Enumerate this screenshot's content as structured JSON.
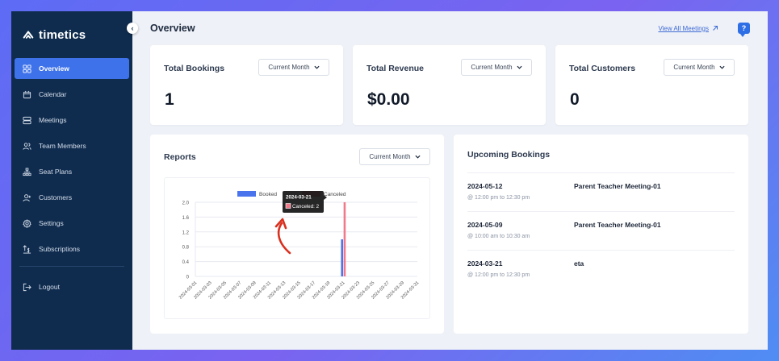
{
  "app": {
    "name": "timetics"
  },
  "sidebar": {
    "items": [
      {
        "label": "Overview",
        "icon": "grid-icon",
        "active": true
      },
      {
        "label": "Calendar",
        "icon": "calendar-icon",
        "active": false
      },
      {
        "label": "Meetings",
        "icon": "meetings-icon",
        "active": false
      },
      {
        "label": "Team Members",
        "icon": "team-icon",
        "active": false
      },
      {
        "label": "Seat Plans",
        "icon": "seat-plan-icon",
        "active": false
      },
      {
        "label": "Customers",
        "icon": "customers-icon",
        "active": false
      },
      {
        "label": "Settings",
        "icon": "gear-icon",
        "active": false
      },
      {
        "label": "Subscriptions",
        "icon": "subscriptions-icon",
        "active": false
      }
    ],
    "logout": "Logout",
    "collapse_glyph": "‹"
  },
  "header": {
    "title": "Overview",
    "view_all": "View All Meetings",
    "help_glyph": "?"
  },
  "stats": [
    {
      "title": "Total Bookings",
      "value": "1",
      "filter": "Current Month"
    },
    {
      "title": "Total Revenue",
      "value": "$0.00",
      "filter": "Current Month"
    },
    {
      "title": "Total Customers",
      "value": "0",
      "filter": "Current Month"
    }
  ],
  "reports": {
    "title": "Reports",
    "filter": "Current Month",
    "tooltip": {
      "date": "2024-03-21",
      "label": "Canceled: 2"
    }
  },
  "chart_data": {
    "type": "bar",
    "title": "",
    "xlabel": "",
    "ylabel": "",
    "ylim": [
      0,
      2.0
    ],
    "yticks": [
      "0",
      "0.4",
      "0.8",
      "1.2",
      "1.6",
      "2.0"
    ],
    "grid": true,
    "legend": "top",
    "categories": [
      "2024-03-01",
      "2024-03-02",
      "2024-03-03",
      "2024-03-04",
      "2024-03-05",
      "2024-03-06",
      "2024-03-07",
      "2024-03-08",
      "2024-03-09",
      "2024-03-10",
      "2024-03-11",
      "2024-03-12",
      "2024-03-13",
      "2024-03-14",
      "2024-03-15",
      "2024-03-16",
      "2024-03-17",
      "2024-03-18",
      "2024-03-19",
      "2024-03-20",
      "2024-03-21",
      "2024-03-22",
      "2024-03-23",
      "2024-03-24",
      "2024-03-25",
      "2024-03-26",
      "2024-03-27",
      "2024-03-28",
      "2024-03-29",
      "2024-03-30",
      "2024-03-31"
    ],
    "xtick_labels": [
      "2024-03-01",
      "2024-03-03",
      "2024-03-05",
      "2024-03-07",
      "2024-03-09",
      "2024-03-11",
      "2024-03-13",
      "2024-03-15",
      "2024-03-17",
      "2024-03-19",
      "2024-03-21",
      "2024-03-23",
      "2024-03-25",
      "2024-03-27",
      "2024-03-29",
      "2024-03-31"
    ],
    "series": [
      {
        "name": "Booked",
        "color": "#4a74ee",
        "values": [
          0,
          0,
          0,
          0,
          0,
          0,
          0,
          0,
          0,
          0,
          0,
          0,
          0,
          0,
          0,
          0,
          0,
          0,
          0,
          0,
          1,
          0,
          0,
          0,
          0,
          0,
          0,
          0,
          0,
          0,
          0
        ]
      },
      {
        "name": "Canceled",
        "color": "#f07a8a",
        "values": [
          0,
          0,
          0,
          0,
          0,
          0,
          0,
          0,
          0,
          0,
          0,
          0,
          0,
          0,
          0,
          0,
          0,
          0,
          0,
          0,
          2,
          0,
          0,
          0,
          0,
          0,
          0,
          0,
          0,
          0,
          0
        ]
      }
    ]
  },
  "upcoming": {
    "title": "Upcoming Bookings",
    "items": [
      {
        "date": "2024-05-12",
        "time": "@ 12:00 pm to 12:30 pm",
        "name": "Parent Teacher Meeting-01"
      },
      {
        "date": "2024-05-09",
        "time": "@ 10:00 am to 10:30 am",
        "name": "Parent Teacher Meeting-01"
      },
      {
        "date": "2024-03-21",
        "time": "@ 12:00 pm to 12:30 pm",
        "name": "eta"
      }
    ]
  },
  "colors": {
    "sidebar": "#0f2c4f",
    "accent": "#3e72ea",
    "annotation_arrow": "#d9301f"
  }
}
